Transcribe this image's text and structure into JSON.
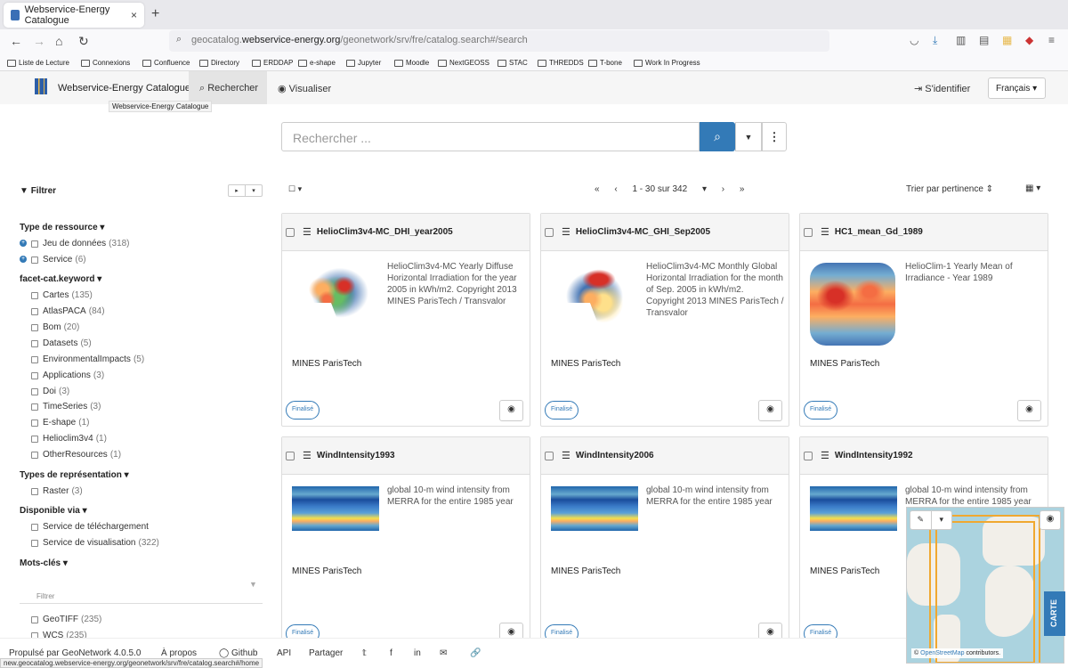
{
  "browser": {
    "tab_title": "Webservice-Energy Catalogue",
    "url_prefix": "geocatalog.",
    "url_domain": "webservice-energy.org",
    "url_path": "/geonetwork/srv/fre/catalog.search#/search",
    "bookmarks": [
      "Liste de Lecture",
      "Connexions",
      "Confluence",
      "Directory",
      "ERDDAP",
      "e-shape",
      "Jupyter",
      "Moodle",
      "NextGEOSS",
      "STAC",
      "THREDDS",
      "T-bone",
      "Work In Progress"
    ],
    "status_url": "new.geocatalog.webservice-energy.org/geonetwork/srv/fre/catalog.search#/home"
  },
  "header": {
    "title": "Webservice-Energy Catalogue",
    "search_tab": "Rechercher",
    "visualize_tab": "Visualiser",
    "login": "S'identifier",
    "language": "Français",
    "tooltip": "Webservice-Energy Catalogue"
  },
  "search": {
    "placeholder": "Rechercher ..."
  },
  "sidebar": {
    "filter_label": "Filtrer",
    "facets": [
      {
        "title": "Type de ressource",
        "items": [
          {
            "label": "Jeu de données",
            "count": "(318)"
          },
          {
            "label": "Service",
            "count": "(6)"
          }
        ]
      },
      {
        "title": "facet-cat.keyword",
        "items": [
          {
            "label": "Cartes",
            "count": "(135)"
          },
          {
            "label": "AtlasPACA",
            "count": "(84)"
          },
          {
            "label": "Bom",
            "count": "(20)"
          },
          {
            "label": "Datasets",
            "count": "(5)"
          },
          {
            "label": "EnvironmentalImpacts",
            "count": "(5)"
          },
          {
            "label": "Applications",
            "count": "(3)"
          },
          {
            "label": "Doi",
            "count": "(3)"
          },
          {
            "label": "TimeSeries",
            "count": "(3)"
          },
          {
            "label": "E-shape",
            "count": "(1)"
          },
          {
            "label": "Helioclim3v4",
            "count": "(1)"
          },
          {
            "label": "OtherResources",
            "count": "(1)"
          }
        ]
      },
      {
        "title": "Types de représentation",
        "items": [
          {
            "label": "Raster",
            "count": "(3)"
          }
        ]
      },
      {
        "title": "Disponible via",
        "items": [
          {
            "label": "Service de téléchargement",
            "count": ""
          },
          {
            "label": "Service de visualisation",
            "count": "(322)"
          }
        ]
      },
      {
        "title": "Mots-clés",
        "items": [
          {
            "label": "GeoTIFF",
            "count": "(235)"
          },
          {
            "label": "WCS",
            "count": "(235)"
          }
        ]
      }
    ],
    "keyword_filter_placeholder": "Filtrer"
  },
  "results": {
    "pager_first": "«",
    "pager_prev": "‹",
    "range": "1 - 30 sur 342",
    "pager_next": "›",
    "pager_last": "»",
    "sort": "Trier par pertinence",
    "cards": [
      {
        "title": "HelioClim3v4-MC_DHI_year2005",
        "desc": "HelioClim3v4-MC Yearly Diffuse Horizontal Irradiation for the year 2005 in kWh/m2. Copyright 2013 MINES ParisTech / Transvalor",
        "org": "MINES ParisTech",
        "status": "Finalisé"
      },
      {
        "title": "HelioClim3v4-MC_GHI_Sep2005",
        "desc": "HelioClim3v4-MC Monthly Global Horizontal Irradiation for the month of Sep. 2005 in kWh/m2. Copyright 2013 MINES ParisTech / Transvalor",
        "org": "MINES ParisTech",
        "status": "Finalisé"
      },
      {
        "title": "HC1_mean_Gd_1989",
        "desc": "HelioClim-1 Yearly Mean of Irradiance - Year 1989",
        "org": "MINES ParisTech",
        "status": "Finalisé"
      },
      {
        "title": "WindIntensity1993",
        "desc": "global 10-m wind intensity from MERRA for the entire 1985 year",
        "org": "MINES ParisTech",
        "status": "Finalisé"
      },
      {
        "title": "WindIntensity2006",
        "desc": "global 10-m wind intensity from MERRA for the entire 1985 year",
        "org": "MINES ParisTech",
        "status": "Finalisé"
      },
      {
        "title": "WindIntensity1992",
        "desc": "global 10-m wind intensity from MERRA for the entire 1985 year",
        "org": "MINES ParisTech",
        "status": "Finalisé"
      }
    ]
  },
  "map": {
    "label": "CARTE",
    "attribution_prefix": "©",
    "attribution_link": "OpenStreetMap",
    "attribution_suffix": "contributors."
  },
  "footer": {
    "powered": "Propulsé par GeoNetwork 4.0.5.0",
    "about": "À propos",
    "github": "Github",
    "api": "API",
    "share": "Partager"
  },
  "colors": {
    "accent": "#337ab7",
    "badge": "#337ab7"
  }
}
